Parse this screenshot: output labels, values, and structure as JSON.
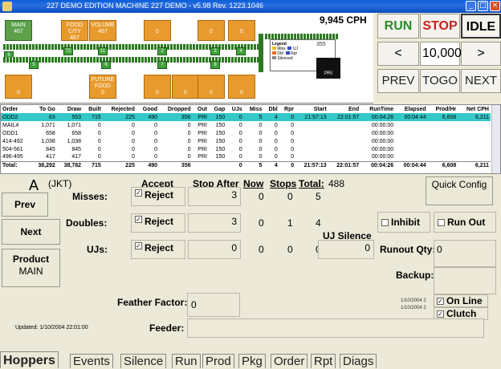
{
  "window": {
    "title": "227 DEMO EDITION   MACHINE 227 DEMO - v5.98 Rev. 1223.1046"
  },
  "machine": {
    "cph": "9,945 CPH",
    "hoppers_top": [
      {
        "label": "MAIN",
        "count": "467",
        "color": "green"
      },
      {
        "label": "FOOD CITY",
        "count": "467",
        "color": "orange"
      },
      {
        "label": "VOLUME",
        "count": "467",
        "color": "orange"
      },
      {
        "label": "",
        "count": "0",
        "color": "orange"
      },
      {
        "label": "",
        "count": "0",
        "color": "orange"
      },
      {
        "label": "",
        "count": "0",
        "color": "orange"
      }
    ],
    "hoppers_bottom": [
      {
        "label": "",
        "count": "0",
        "color": "orange"
      },
      {
        "label": "FUTURE FOOD",
        "count": "0",
        "color": "orange"
      },
      {
        "label": "",
        "count": "0",
        "color": "orange"
      },
      {
        "label": "",
        "count": "0",
        "color": "orange"
      },
      {
        "label": "",
        "count": "0",
        "color": "orange"
      },
      {
        "label": "",
        "count": "0",
        "color": "orange"
      }
    ],
    "station_numbers": [
      "8",
      "72",
      "11",
      "2",
      "3",
      "4",
      "5",
      "6",
      "7",
      "8"
    ],
    "legend_title": "Legend",
    "legend_items": [
      "Miss",
      "UJ",
      "Dbl",
      "Rpr",
      "Silenced"
    ],
    "pri_label": "PRI",
    "rate_top": "355"
  },
  "controls": {
    "run": "RUN",
    "stop": "STOP",
    "idle": "IDLE",
    "prev_arrow": "<",
    "rate_value": "10,000",
    "next_arrow": ">",
    "prev": "PREV",
    "togo": "TOGO",
    "next": "NEXT"
  },
  "orders": {
    "columns": [
      "Order",
      "To Go",
      "Draw",
      "Built",
      "Rejected",
      "Good",
      "Dropped",
      "Out",
      "Gap",
      "UJs",
      "Miss",
      "Dbl",
      "Rpr",
      "Start",
      "End",
      "RunTime",
      "Elapsed",
      "Prod/Hr",
      "Net CPH"
    ],
    "rows": [
      [
        "ODD2",
        "63",
        "553",
        "715",
        "225",
        "490",
        "356",
        "PRI",
        "150",
        "0",
        "5",
        "4",
        "0",
        "21:57:13",
        "22:01:57",
        "00:04:26",
        "00:04:44",
        "6,608",
        "6,211"
      ],
      [
        "MAIL4",
        "1,071",
        "1,071",
        "0",
        "0",
        "0",
        "0",
        "PRI",
        "150",
        "0",
        "0",
        "0",
        "0",
        "",
        "",
        "00:00:00",
        "",
        "",
        ""
      ],
      [
        "ODD1",
        "658",
        "658",
        "0",
        "0",
        "0",
        "0",
        "PRI",
        "150",
        "0",
        "0",
        "0",
        "0",
        "",
        "",
        "00:00:00",
        "",
        "",
        ""
      ],
      [
        "414-492",
        "1,038",
        "1,038",
        "0",
        "0",
        "0",
        "0",
        "PRI",
        "150",
        "0",
        "0",
        "0",
        "0",
        "",
        "",
        "00:00:00",
        "",
        "",
        ""
      ],
      [
        "504-561",
        "845",
        "845",
        "0",
        "0",
        "0",
        "0",
        "PRI",
        "150",
        "0",
        "0",
        "0",
        "0",
        "",
        "",
        "00:00:00",
        "",
        "",
        ""
      ],
      [
        "496-495",
        "417",
        "417",
        "0",
        "0",
        "0",
        "0",
        "PRI",
        "150",
        "0",
        "0",
        "0",
        "0",
        "",
        "",
        "00:00:00",
        "",
        "",
        ""
      ]
    ],
    "total": [
      "Total:",
      "38,292",
      "38,782",
      "715",
      "225",
      "490",
      "356",
      "",
      "",
      "0",
      "5",
      "4",
      "0",
      "21:57:13",
      "22:01:57",
      "00:04:26",
      "00:04:44",
      "6,608",
      "6,211"
    ]
  },
  "hopper": {
    "station": "A",
    "operator": "(JKT)",
    "prev": "Prev",
    "next": "Next",
    "product_label": "Product",
    "product_value": "MAIN",
    "headers": {
      "accept": "Accept",
      "stop_after": "Stop After",
      "now": "Now",
      "stops": "Stops",
      "total": "Total:",
      "total_value": "488"
    },
    "rows": [
      {
        "label": "Misses:",
        "accept": "Reject",
        "stop_after": "3",
        "now": "0",
        "stops": "0",
        "total": "5"
      },
      {
        "label": "Doubles:",
        "accept": "Reject",
        "stop_after": "3",
        "now": "0",
        "stops": "1",
        "total": "4"
      },
      {
        "label": "UJs:",
        "accept": "Reject",
        "stop_after": "0",
        "now": "0",
        "stops": "0",
        "total": "0"
      }
    ],
    "uj_silence_label": "UJ Silence",
    "uj_silence_value": "0",
    "quick_config": "Quick Config",
    "inhibit": "Inhibit",
    "run_out": "Run Out",
    "runout_qty_label": "Runout Qty:",
    "runout_qty_value": "0",
    "backup_label": "Backup:",
    "date1": "1/10/2004 2",
    "date2": "1/10/2004 2",
    "on_line": "On Line",
    "clutch": "Clutch",
    "feather_label": "Feather Factor:",
    "feather_value": "0",
    "feeder_label": "Feeder:",
    "updated": "Updated:  1/10/2004 22:01:00"
  },
  "tabs": [
    "Hoppers",
    "Events",
    "Silence",
    "Run",
    "Prod",
    "Pkg",
    "Order",
    "Rpt",
    "Diags"
  ]
}
